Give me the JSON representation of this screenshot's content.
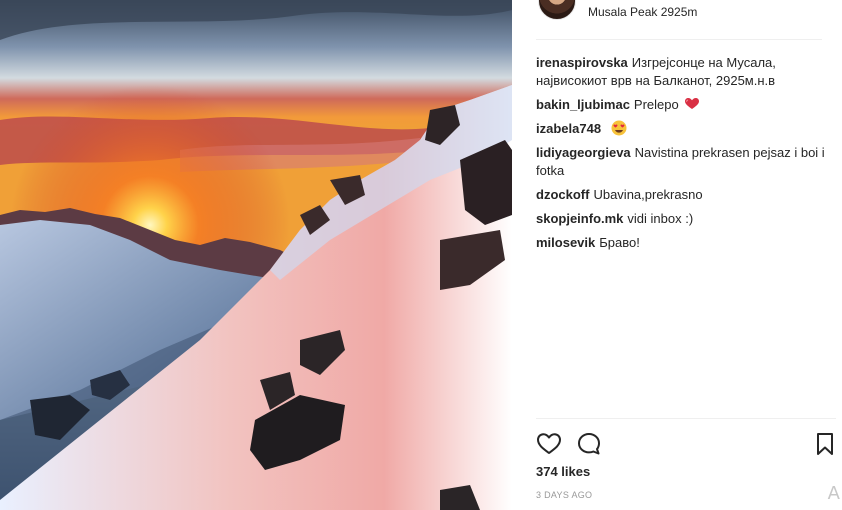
{
  "post": {
    "location": "Musala Peak 2925m",
    "likes": "374 likes",
    "time": "3 DAYS AGO"
  },
  "comments": [
    {
      "user": "irenaspirovska",
      "text": "Изгрејсонце на Мусала, највисокиот врв на Балканот, 2925м.н.в",
      "emoji": ""
    },
    {
      "user": "bakin_ljubimac",
      "text": "Prelepo",
      "emoji": "heart"
    },
    {
      "user": "izabela748",
      "text": "",
      "emoji": "heart-eyes"
    },
    {
      "user": "lidiyageorgieva",
      "text": "Navistina prekrasen pejsaz i boi i fotka",
      "emoji": ""
    },
    {
      "user": "dzockoff",
      "text": "Ubavina,prekrasno",
      "emoji": ""
    },
    {
      "user": "skopjeinfo.mk",
      "text": "vidi inbox :)",
      "emoji": ""
    },
    {
      "user": "milosevik",
      "text": "Браво!",
      "emoji": ""
    }
  ],
  "icons": {
    "like": "heart-icon",
    "comment": "comment-icon",
    "save": "bookmark-icon"
  },
  "corner_glyph": "A",
  "colors": {
    "text": "#262626",
    "muted": "#999999",
    "divider": "#efefef"
  }
}
